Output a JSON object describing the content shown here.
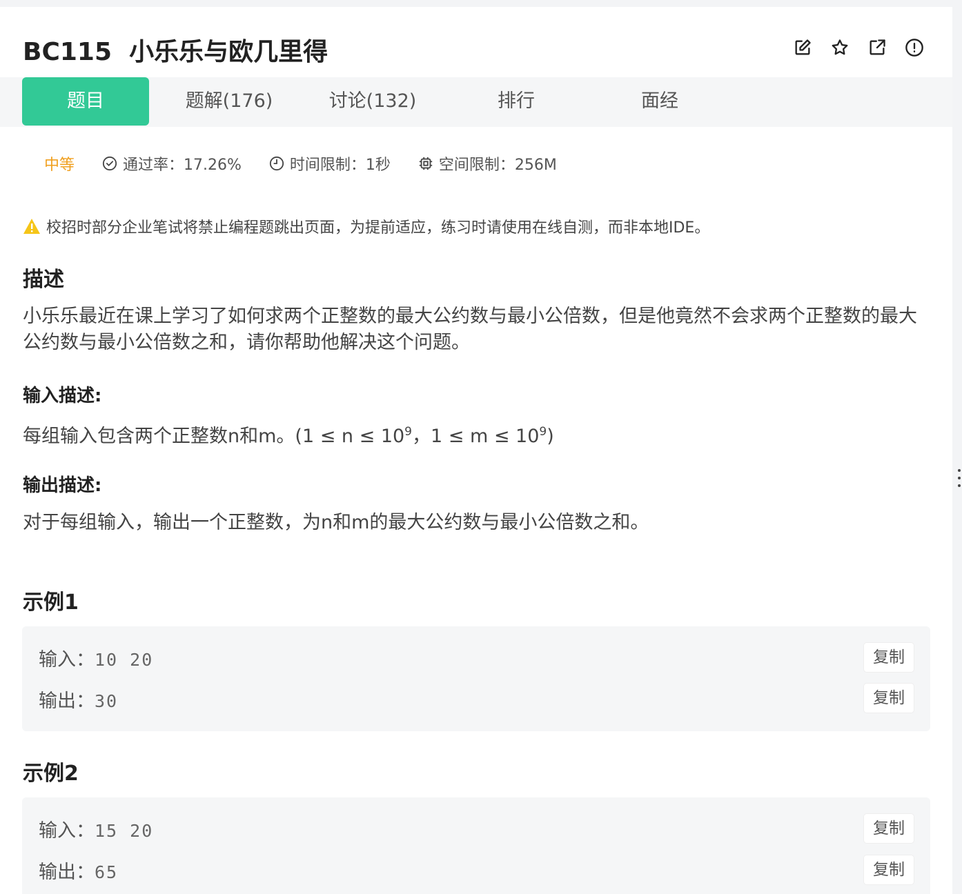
{
  "header": {
    "title": "BC115  小乐乐与欧几里得",
    "icons": [
      "edit-icon",
      "star-icon",
      "share-icon",
      "report-icon"
    ]
  },
  "tabs": [
    {
      "label": "题目",
      "active": true
    },
    {
      "label": "题解(176)",
      "active": false
    },
    {
      "label": "讨论(132)",
      "active": false
    },
    {
      "label": "排行",
      "active": false
    },
    {
      "label": "面经",
      "active": false
    }
  ],
  "meta": {
    "difficulty": "中等",
    "pass_rate": "通过率：17.26%",
    "time_limit": "时间限制：1秒",
    "space_limit": "空间限制：256M"
  },
  "notice": "校招时部分企业笔试将禁止编程题跳出页面，为提前适应，练习时请使用在线自测，而非本地IDE。",
  "description": {
    "heading": "描述",
    "text": "小乐乐最近在课上学习了如何求两个正整数的最大公约数与最小公倍数，但是他竟然不会求两个正整数的最大公约数与最小公倍数之和，请你帮助他解决这个问题。"
  },
  "input_desc": {
    "heading": "输入描述:",
    "prefix": "每组输入包含两个正整数n和m。(1 ≤ n ≤ 10",
    "exp1": "9",
    "middle": "，1 ≤ m ≤ 10",
    "exp2": "9",
    "suffix": ")"
  },
  "output_desc": {
    "heading": "输出描述:",
    "text": "对于每组输入，输出一个正整数，为n和m的最大公约数与最小公倍数之和。"
  },
  "examples": [
    {
      "heading": "示例1",
      "input_label": "输入：",
      "input": "10 20",
      "output_label": "输出：",
      "output": "30",
      "copy": "复制"
    },
    {
      "heading": "示例2",
      "input_label": "输入：",
      "input": "15 20",
      "output_label": "输出：",
      "output": "65",
      "copy": "复制"
    }
  ],
  "colors": {
    "accent": "#32c996",
    "difficulty": "#f0a020",
    "warning": "#f5c518"
  }
}
